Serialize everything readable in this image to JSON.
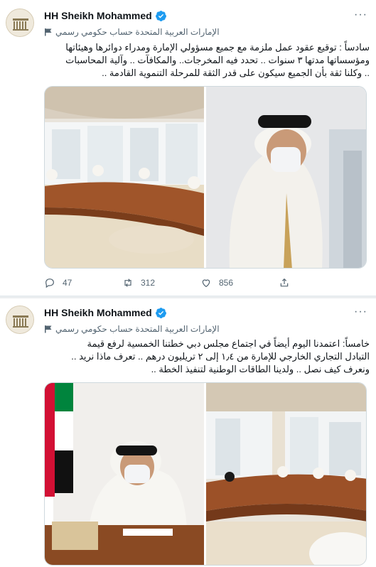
{
  "tweets": [
    {
      "author_name": "HH Sheikh Mohammed",
      "account_label": "الإمارات العربية المتحدة حساب حكومي رسمي",
      "more_label": "···",
      "text_lines": [
        "سادساً : توقيع عقود عمل ملزمة مع جميع مسؤولي الإمارة ومدراء دوائرها وهيئاتها",
        "ومؤسساتها مدتها ٣ سنوات .. تحدد فيه المخرجات.. والمكافآت .. وآلية المحاسبات",
        ".. وكلنا ثقة بأن الجميع سيكون على قدر الثقة للمرحلة التنموية القادمة .."
      ],
      "reply_count": "47",
      "retweet_count": "312",
      "like_count": "856",
      "share_label": ""
    },
    {
      "author_name": "HH Sheikh Mohammed",
      "account_label": "الإمارات العربية المتحدة حساب حكومي رسمي",
      "more_label": "···",
      "text_lines": [
        "خامساً: اعتمدنا اليوم أيضاً في اجتماع مجلس دبي خطتنا الخمسية لرفع قيمة",
        "التبادل التجاري الخارجي للإمارة من ١٫٤ إلى ٢ تريليون درهم .. تعرف ماذا نريد ..",
        "ونعرف كيف نصل .. ولدينا الطاقات الوطنية لتنفيذ الخطة .."
      ]
    }
  ],
  "colors": {
    "verified": "#1d9bf0",
    "secondary_text": "#536471",
    "divider": "#ebeef0"
  },
  "icons": [
    "verified-badge-icon",
    "government-flag-icon",
    "reply-icon",
    "retweet-icon",
    "like-icon",
    "share-icon",
    "more-icon"
  ]
}
